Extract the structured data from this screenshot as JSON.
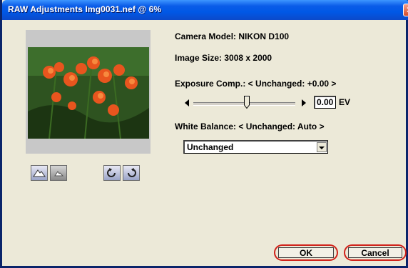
{
  "window": {
    "title": "RAW Adjustments Img0031.nef @ 6%",
    "close_glyph": "✕"
  },
  "info": {
    "camera_model": "Camera Model: NIKON D100",
    "image_size": "Image Size: 3008 x 2000",
    "exposure_label": "Exposure Comp.: < Unchanged: +0.00 >",
    "ev_value": "0.00",
    "ev_unit": "EV",
    "white_balance_label": "White Balance: < Unchanged: Auto >",
    "white_balance_selected": "Unchanged"
  },
  "toolbar": {
    "icons": [
      "mountain-large-icon",
      "mountain-small-icon",
      "rotate-ccw-icon",
      "rotate-cw-icon"
    ]
  },
  "buttons": {
    "ok": "OK",
    "cancel": "Cancel"
  },
  "colors": {
    "title_bar": "#0058E6",
    "highlight_ring": "#D0221A",
    "dialog_bg": "#ECE9D8"
  }
}
